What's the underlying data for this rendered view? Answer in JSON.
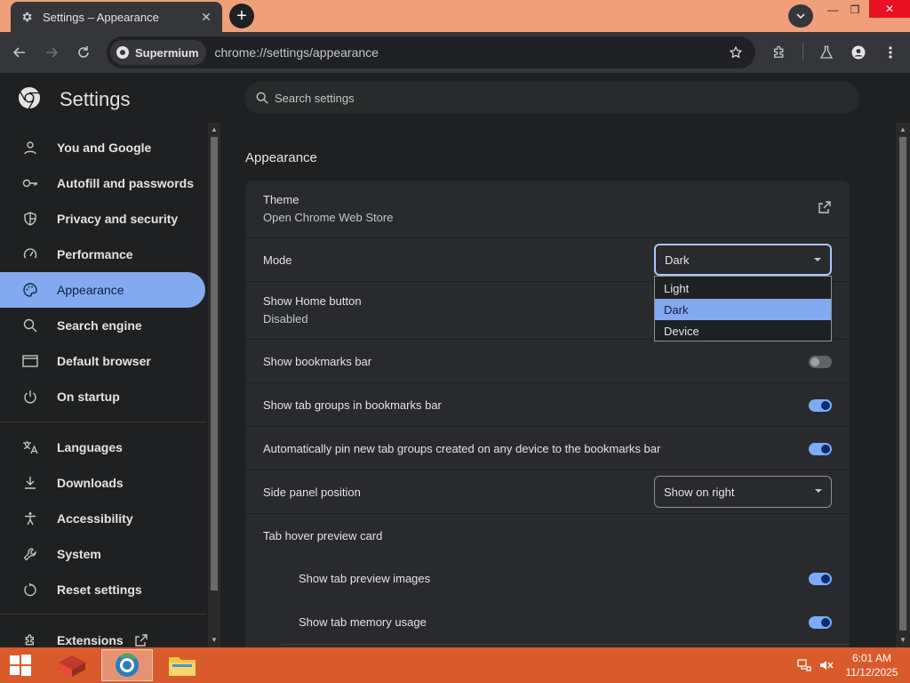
{
  "browser": {
    "tab_title": "Settings – Appearance",
    "chip_label": "Supermium",
    "url": "chrome://settings/appearance"
  },
  "settings": {
    "app_title": "Settings",
    "search_placeholder": "Search settings",
    "sidebar": {
      "items": [
        {
          "label": "You and Google",
          "icon": "person-icon"
        },
        {
          "label": "Autofill and passwords",
          "icon": "key-icon"
        },
        {
          "label": "Privacy and security",
          "icon": "shield-icon"
        },
        {
          "label": "Performance",
          "icon": "speedometer-icon"
        },
        {
          "label": "Appearance",
          "icon": "palette-icon",
          "active": true
        },
        {
          "label": "Search engine",
          "icon": "search-icon"
        },
        {
          "label": "Default browser",
          "icon": "browser-window-icon"
        },
        {
          "label": "On startup",
          "icon": "power-icon"
        },
        {
          "label": "Languages",
          "icon": "translate-icon"
        },
        {
          "label": "Downloads",
          "icon": "download-icon"
        },
        {
          "label": "Accessibility",
          "icon": "accessibility-icon"
        },
        {
          "label": "System",
          "icon": "wrench-icon"
        },
        {
          "label": "Reset settings",
          "icon": "reset-icon"
        },
        {
          "label": "Extensions",
          "icon": "puzzle-icon"
        }
      ]
    },
    "section_title": "Appearance",
    "rows": {
      "theme_label": "Theme",
      "theme_sub": "Open Chrome Web Store",
      "mode_label": "Mode",
      "mode_value": "Dark",
      "home_label": "Show Home button",
      "home_sub": "Disabled",
      "bookmarks_label": "Show bookmarks bar",
      "bookmarks_on": false,
      "tabgroups_label": "Show tab groups in bookmarks bar",
      "tabgroups_on": true,
      "autopin_label": "Automatically pin new tab groups created on any device to the bookmarks bar",
      "autopin_on": true,
      "sidepanel_label": "Side panel position",
      "sidepanel_value": "Show on right",
      "hover_label": "Tab hover preview card",
      "preview_images_label": "Show tab preview images",
      "preview_images_on": true,
      "memory_label": "Show tab memory usage",
      "memory_on": true
    },
    "mode_dropdown": {
      "options": [
        "Light",
        "Dark",
        "Device"
      ],
      "selected": "Dark"
    }
  },
  "taskbar": {
    "time": "6:01 AM",
    "date": "11/12/2025"
  },
  "colors": {
    "accent": "#83aaf0",
    "toggle_on": "#7cacf8",
    "taskbar": "#d95a2a",
    "titlebar": "#f0a078"
  }
}
